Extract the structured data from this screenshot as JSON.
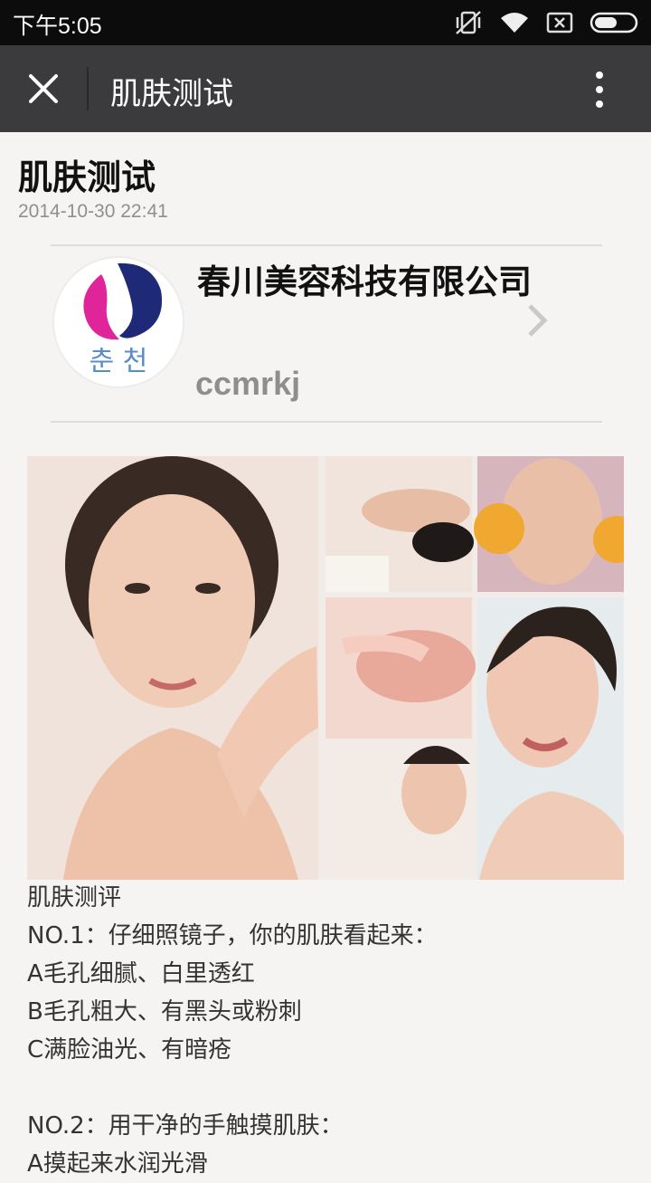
{
  "status_bar": {
    "time": "下午5:05"
  },
  "title_bar": {
    "title": "肌肤测试"
  },
  "article": {
    "title": "肌肤测试",
    "date": "2014-10-30 22:41"
  },
  "account": {
    "name": "春川美容科技有限公司",
    "id": "ccmrkj",
    "logo_text": "춘 천"
  },
  "body_lines": [
    "肌肤测评",
    "NO.1：仔细照镜子，你的肌肤看起来：",
    "A毛孔细腻、白里透红",
    "B毛孔粗大、有黑头或粉刺",
    "C满脸油光、有暗疮",
    "",
    "NO.2：用干净的手触摸肌肤：",
    "A摸起来水润光滑"
  ],
  "icons": {
    "mute": "vibrate-off-icon",
    "wifi": "wifi-icon",
    "sim": "sim-x-icon",
    "battery": "battery-icon",
    "close": "close-icon",
    "more": "more-vertical-icon",
    "chevron": "chevron-right-icon"
  },
  "colors": {
    "status_bar": "#0c0c0c",
    "title_bar": "#3b3b3d",
    "page_bg": "#f5f4f2",
    "logo_magenta": "#e0249a",
    "logo_navy": "#1e2a78"
  }
}
